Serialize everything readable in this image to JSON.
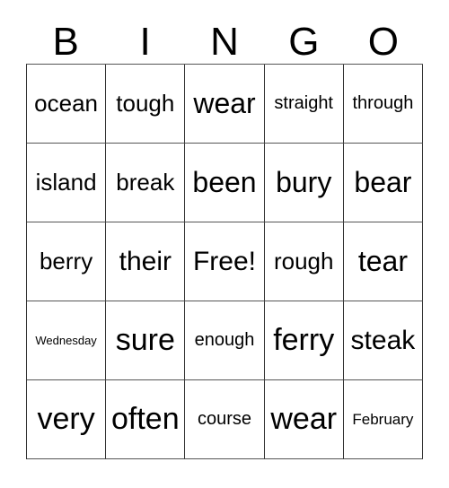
{
  "card": {
    "headers": [
      "B",
      "I",
      "N",
      "G",
      "O"
    ],
    "free_space_label": "Free!",
    "rows": [
      [
        {
          "text": "ocean",
          "size": "m"
        },
        {
          "text": "tough",
          "size": "m"
        },
        {
          "text": "wear",
          "size": "xl"
        },
        {
          "text": "straight",
          "size": "s"
        },
        {
          "text": "through",
          "size": "s"
        }
      ],
      [
        {
          "text": "island",
          "size": "m"
        },
        {
          "text": "break",
          "size": "m"
        },
        {
          "text": "been",
          "size": "xl"
        },
        {
          "text": "bury",
          "size": "xl"
        },
        {
          "text": "bear",
          "size": "xl"
        }
      ],
      [
        {
          "text": "berry",
          "size": "m"
        },
        {
          "text": "their",
          "size": "l"
        },
        {
          "text": "Free!",
          "size": "l"
        },
        {
          "text": "rough",
          "size": "m"
        },
        {
          "text": "tear",
          "size": "xl"
        }
      ],
      [
        {
          "text": "Wednesday",
          "size": "xxs"
        },
        {
          "text": "sure",
          "size": "xxl"
        },
        {
          "text": "enough",
          "size": "s"
        },
        {
          "text": "ferry",
          "size": "xxl"
        },
        {
          "text": "steak",
          "size": "l"
        }
      ],
      [
        {
          "text": "very",
          "size": "xxl"
        },
        {
          "text": "often",
          "size": "xxl"
        },
        {
          "text": "course",
          "size": "s"
        },
        {
          "text": "wear",
          "size": "xxl"
        },
        {
          "text": "February",
          "size": "xs"
        }
      ]
    ]
  }
}
